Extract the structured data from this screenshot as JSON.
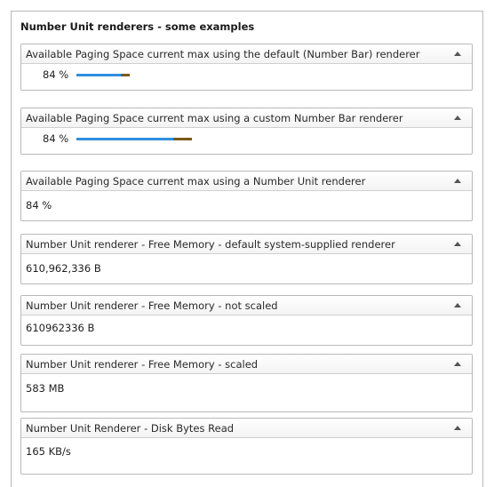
{
  "main_title": "Number Unit renderers - some examples",
  "icons": {
    "collapse": "chevron-up-icon"
  },
  "colors": {
    "bar_fill": "#2f8fe0",
    "bar_rest": "#7a5a1a"
  },
  "panels": [
    {
      "title": "Available Paging Space current max using the default (Number Bar) renderer",
      "value": "84 %",
      "bar_fraction": 0.84,
      "type": "bar",
      "bar_width": 60
    },
    {
      "title": "Available Paging Space current max using a custom Number Bar renderer",
      "value": "84 %",
      "bar_fraction": 0.84,
      "type": "bar",
      "bar_width": 130
    },
    {
      "title": "Available Paging Space current max using a Number Unit renderer",
      "value": "84 %",
      "type": "text"
    },
    {
      "title": "Number Unit renderer - Free Memory - default system-supplied renderer",
      "value": "610,962,336 B",
      "type": "text"
    },
    {
      "title": "Number Unit renderer - Free Memory - not scaled",
      "value": "610962336 B",
      "type": "text"
    },
    {
      "title": "Number Unit renderer - Free Memory - scaled",
      "value": "583 MB",
      "type": "text"
    },
    {
      "title": "Number Unit Renderer - Disk Bytes Read",
      "value": "165 KB/s",
      "type": "text"
    }
  ]
}
